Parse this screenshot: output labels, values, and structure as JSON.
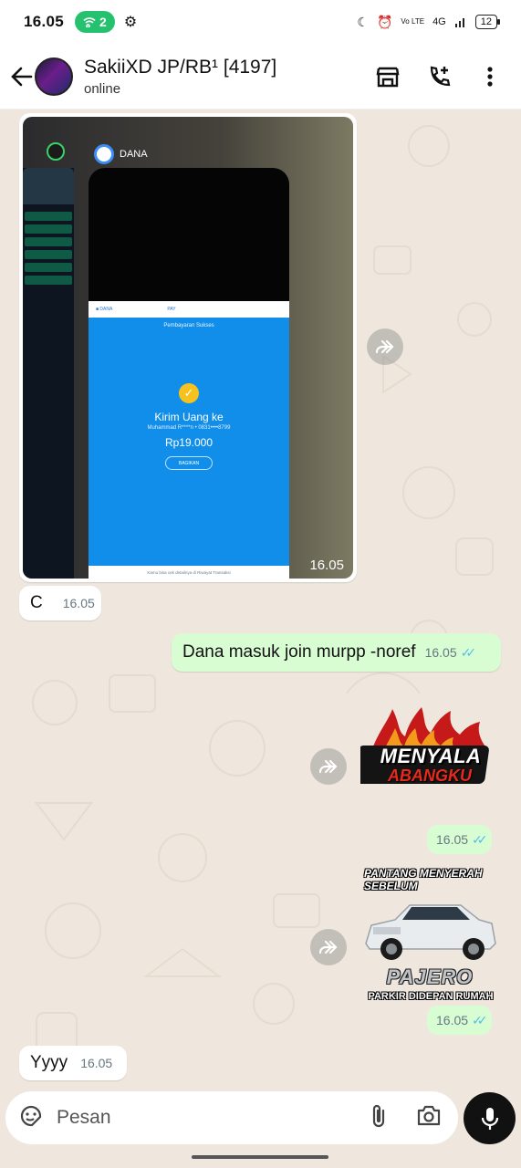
{
  "status_bar": {
    "time": "16.05",
    "hotspot_count": "2",
    "network": "Vo LTE",
    "signal": "4G",
    "battery": "12"
  },
  "header": {
    "title": "SakiiXD JP/RB¹ [4197]",
    "subtitle": "online"
  },
  "messages": [
    {
      "type": "image",
      "direction": "incoming",
      "time": "16.05",
      "screenshot_text": {
        "app_name": "DANA",
        "pay_label": "PAY",
        "status": "Pembayaran Sukses",
        "heading": "Kirim Uang ke",
        "recipient": "Muhammad R****n • 0831••••8799",
        "amount": "Rp19.000",
        "share": "BAGIKAN",
        "footer": "Kamu bisa cek detailnya di Riwayat Transaksi"
      }
    },
    {
      "type": "text",
      "direction": "incoming",
      "text": "C",
      "time": "16.05"
    },
    {
      "type": "text",
      "direction": "outgoing",
      "text": "Dana masuk join murpp -noref",
      "time": "16.05",
      "read": true
    },
    {
      "type": "sticker",
      "direction": "outgoing",
      "time": "16.05",
      "lines": [
        "MENYALA",
        "ABANGKU"
      ],
      "read": true
    },
    {
      "type": "sticker",
      "direction": "outgoing",
      "time": "16.05",
      "lines": [
        "PANTANG MENYERAH",
        "SEBELUM",
        "PAJERO",
        "PARKIR DIDEPAN RUMAH"
      ],
      "read": true
    },
    {
      "type": "text",
      "direction": "incoming",
      "text": "Yyyy",
      "time": "16.05"
    }
  ],
  "composer": {
    "placeholder": "Pesan"
  },
  "colors": {
    "wallpaper": "#efe7dd",
    "outgoing_bubble": "#d9fdd3",
    "incoming_bubble": "#ffffff",
    "read_ticks": "#53bdeb",
    "dana_blue": "#118ee9"
  }
}
